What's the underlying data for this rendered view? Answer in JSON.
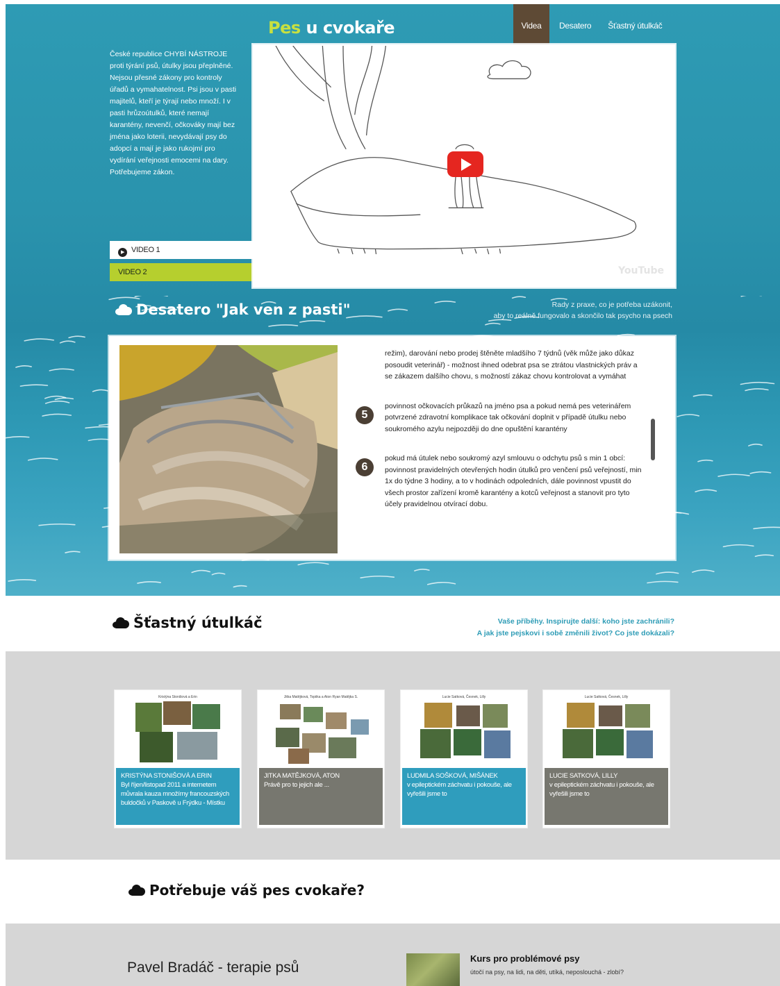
{
  "site": {
    "logo_accent": "Pes",
    "logo_rest": " u cvokaře"
  },
  "nav": {
    "items": [
      "Videa",
      "Desatero",
      "Šťastný útulkáč"
    ]
  },
  "hero": {
    "intro": "České republice CHYBÍ NÁSTROJE proti týrání psů, útulky jsou přeplněné. Nejsou přesné zákony pro kontroly úřadů a vymahatelnost. Psi jsou v pasti majitelů, kteří je týrají nebo množí. I v pasti hrůzoútulků, které nemají karantény, nevenčí, očkováky mají bez jména jako loterii, nevydávají psy do adopcí a mají je jako rukojmí pro vydírání veřejnosti emocemi na dary. Potřebujeme zákon.",
    "video_tabs": [
      "VIDEO 1",
      "VIDEO 2"
    ],
    "yt_logo": "YouTube"
  },
  "desatero": {
    "title": "Desatero  \"Jak ven z pasti\"",
    "side_line1": "Rady z praxe, co je potřeba uzákonit,",
    "side_line2": "aby to reálně fungovalo a skončilo tak psycho na psech",
    "items": [
      {
        "num": "",
        "text": "režim), darování nebo prodej štěněte mladšího 7 týdnů (věk může jako důkaz posoudit veterinář) - možnost ihned odebrat psa se ztrátou vlastnických práv a se zákazem dalšího chovu, s možností zákaz chovu kontrolovat a vymáhat"
      },
      {
        "num": "5",
        "text": "povinnost očkovacích průkazů na jméno psa a pokud nemá pes veterinářem potvrzené zdravotní komplikace tak očkování doplnit v případě útulku nebo soukromého azylu nejpozději do dne opuštění karantény"
      },
      {
        "num": "6",
        "text": "pokud má útulek nebo soukromý azyl smlouvu o odchytu psů s min 1 obcí: povinnost pravidelných otevřených hodin útulků pro venčení psů veřejností, min 1x do týdne 3 hodiny, a to v hodinách odpoledních, dále povinnost vpustit do všech prostor zařízení kromě karantény a kotců veřejnost  a stanovit pro tyto účely pravidelnou otvírací dobu."
      }
    ]
  },
  "happy": {
    "title": "Šťastný útulkáč",
    "side_line1": "Vaše příběhy. Inspirujte další: koho jste zachránili?",
    "side_line2": "A jak jste pejskovi i sobě změnili život? Co jste dokázali?",
    "cards": [
      {
        "caption": "Kristýna Stonišová a Erin",
        "name": "KRISTÝNA STONIŠOVÁ A ERIN",
        "text": "Byl říjen/listopad 2011 a internetem můvrala kauza množírny francouzských buldočků v Paskově u Frýdku - Místku",
        "style": "blue"
      },
      {
        "caption": "Jitka Matějková, Topiika a Aton Ryan Matějka S.",
        "name": "JITKA MATĚJKOVÁ, ATON",
        "text": "Právě pro to jejich ale ...",
        "style": "grey"
      },
      {
        "caption": "Lucie Satková, Česnek, Lilly",
        "name": "LUDMILA SOŠKOVÁ, MIŠÁNEK",
        "text": "v epileptickém záchvatu i pokouše, ale vyřešili jsme to",
        "style": "blue"
      },
      {
        "caption": "Lucie Satková, Česnek, Lilly",
        "name": "LUCIE SATKOVÁ, LILLY",
        "text": "v epileptickém záchvatu i pokouše, ale vyřešili jsme to",
        "style": "grey"
      }
    ]
  },
  "need": {
    "title": "Potřebuje váš pes cvokaře?",
    "therapist": "Pavel Bradáč - terapie psů",
    "course_title": "Kurs pro problémové psy",
    "course_text": "útočí na psy, na lidi, na děti, utíká, neposlouchá - zlobí?"
  },
  "colors": {
    "accent_green": "#b6cf2e",
    "nav_active": "#5e4a35",
    "link_blue": "#2e9cb6",
    "youtube_red": "#e52620"
  }
}
